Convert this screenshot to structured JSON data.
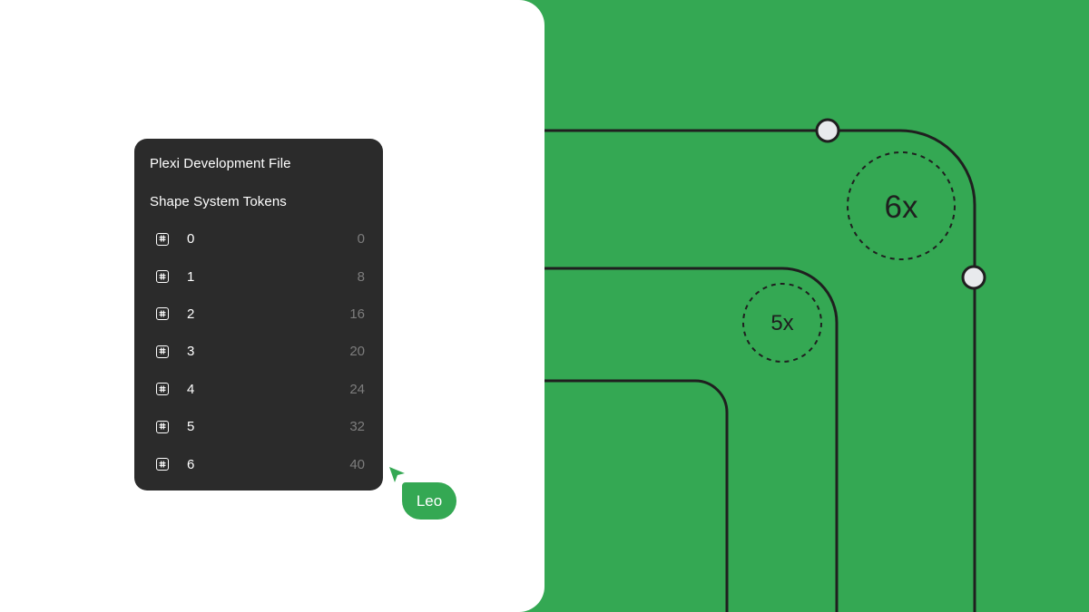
{
  "panel": {
    "title": "Plexi Development File",
    "subtitle": "Shape System Tokens",
    "tokens": [
      {
        "name": "0",
        "value": "0"
      },
      {
        "name": "1",
        "value": "8"
      },
      {
        "name": "2",
        "value": "16"
      },
      {
        "name": "3",
        "value": "20"
      },
      {
        "name": "4",
        "value": "24"
      },
      {
        "name": "5",
        "value": "32"
      },
      {
        "name": "6",
        "value": "40"
      }
    ],
    "token_icon": "hash-icon"
  },
  "cursor": {
    "label": "Leo",
    "icon": "cursor-arrow-icon"
  },
  "illustration": {
    "large_radius_label": "6x",
    "small_radius_label": "5x"
  },
  "colors": {
    "background_green": "#34a853",
    "panel_dark": "#2b2b2b",
    "line": "#1f1f1f",
    "handle_fill": "#e8eaed"
  }
}
